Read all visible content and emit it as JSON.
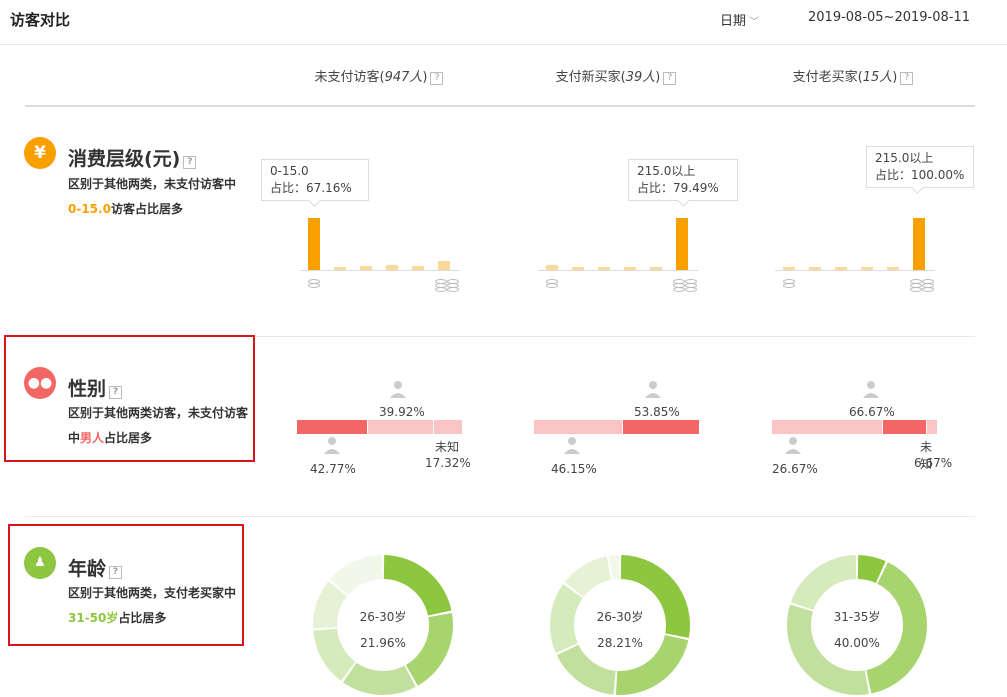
{
  "header": {
    "title": "访客对比",
    "date_label": "日期",
    "date_range": "2019-08-05~2019-08-11"
  },
  "columns": [
    {
      "label_prefix": "未支付访客(",
      "count": "947人",
      "label_suffix": ")"
    },
    {
      "label_prefix": "支付新买家(",
      "count": "39人",
      "label_suffix": ")"
    },
    {
      "label_prefix": "支付老买家(",
      "count": "15人",
      "label_suffix": ")"
    }
  ],
  "help_icon": "?",
  "sections": {
    "spending": {
      "icon": "¥",
      "title": "消费层级(元)",
      "desc_before": "区别于其他两类，未支付访客中",
      "desc_highlight": "0-15.0",
      "desc_after": "访客占比居多",
      "colors": {
        "main": "#f8a000",
        "light": "#fcd99a"
      },
      "charts": [
        {
          "tip_range": "0-15.0",
          "tip_share": "占比：67.16%",
          "values": [
            67.16,
            2,
            5,
            6,
            5,
            11
          ]
        },
        {
          "tip_range": "215.0以上",
          "tip_share": "占比：79.49%",
          "values": [
            7.69,
            2,
            2,
            5,
            5,
            79.49
          ]
        },
        {
          "tip_range": "215.0以上",
          "tip_share": "占比：100.00%",
          "values": [
            1,
            1,
            1,
            1,
            1,
            100
          ]
        }
      ]
    },
    "gender": {
      "title": "性别",
      "desc_before": "区别于其他两类访客，未支付访客中",
      "desc_highlight": "男人",
      "desc_after": "占比居多",
      "colors": {
        "male": "#f36666",
        "female": "#fbc4c4",
        "unknown": "#fbc4c4"
      },
      "charts": [
        {
          "female_pct": "39.92%",
          "male_pct": "42.77%",
          "unknown_label": "未知",
          "unknown_pct": "17.32%",
          "male": 42.77,
          "female": 39.92,
          "unknown": 17.32
        },
        {
          "female_pct": "53.85%",
          "male_pct": "46.15%",
          "male": 46.15,
          "female": 53.85,
          "unknown": 0
        },
        {
          "female_pct": "66.67%",
          "male_pct": "26.67%",
          "unknown_label": "未知",
          "unknown_pct": "6.67%",
          "male": 26.67,
          "female": 66.67,
          "unknown": 6.67
        }
      ]
    },
    "age": {
      "title": "年龄",
      "desc_before": "区别于其他两类，支付老买家中",
      "desc_highlight": "31-50岁",
      "desc_after": "占比居多",
      "colors": [
        "#8dc63f",
        "#a8d46f",
        "#c2e09d",
        "#d6ebbc",
        "#e6f2d6",
        "#f1f8e9"
      ],
      "charts": [
        {
          "center_label": "26-30岁",
          "center_pct": "21.96%",
          "values": [
            21.96,
            20,
            18,
            14,
            12,
            14
          ]
        },
        {
          "center_label": "26-30岁",
          "center_pct": "28.21%",
          "values": [
            28.21,
            23,
            17,
            17,
            12,
            2.79
          ]
        },
        {
          "center_label": "31-35岁",
          "center_pct": "40.00%",
          "values": [
            7,
            40,
            33,
            20
          ]
        }
      ]
    }
  }
}
